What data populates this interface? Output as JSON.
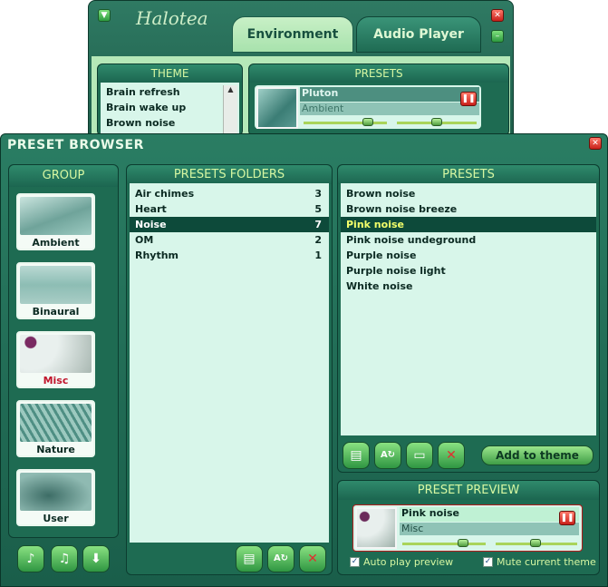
{
  "app": {
    "logo_text": "Halotea"
  },
  "tabs": [
    {
      "label": "Environment"
    },
    {
      "label": "Audio Player"
    }
  ],
  "back": {
    "theme_header": "THEME",
    "theme_items": [
      "Brain refresh",
      "Brain wake up",
      "Brown noise"
    ],
    "presets_header": "PRESETS",
    "preset_name": "Pluton",
    "preset_group": "Ambient"
  },
  "browser": {
    "title": "PRESET BROWSER",
    "group_header": "GROUP",
    "groups": [
      {
        "label": "Ambient",
        "selected": false
      },
      {
        "label": "Binaural",
        "selected": false
      },
      {
        "label": "Misc",
        "selected": true
      },
      {
        "label": "Nature",
        "selected": false
      },
      {
        "label": "User",
        "selected": false
      }
    ],
    "folders_header": "PRESETS FOLDERS",
    "folders": [
      {
        "name": "Air chimes",
        "count": "3"
      },
      {
        "name": "Heart",
        "count": "5"
      },
      {
        "name": "Noise",
        "count": "7"
      },
      {
        "name": "OM",
        "count": "2"
      },
      {
        "name": "Rhythm",
        "count": "1"
      }
    ],
    "selected_folder": "Noise",
    "presets_header": "PRESETS",
    "presets": [
      "Brown noise",
      "Brown noise breeze",
      "Pink noise",
      "Pink noise undeground",
      "Purple noise",
      "Purple noise light",
      "White noise"
    ],
    "selected_preset": "Pink noise",
    "add_button": "Add to theme",
    "preview_header": "PRESET PREVIEW",
    "preview_name": "Pink noise",
    "preview_group": "Misc",
    "auto_play_label": "Auto play preview",
    "auto_play_checked": true,
    "mute_label": "Mute current theme",
    "mute_checked": true
  },
  "colors": {
    "accent": "#f3ff6a",
    "header_text": "#d6f7a2",
    "list_bg": "#d8f6ea",
    "selected_bg": "#0d4a3a",
    "misc_label": "#c0142b"
  }
}
